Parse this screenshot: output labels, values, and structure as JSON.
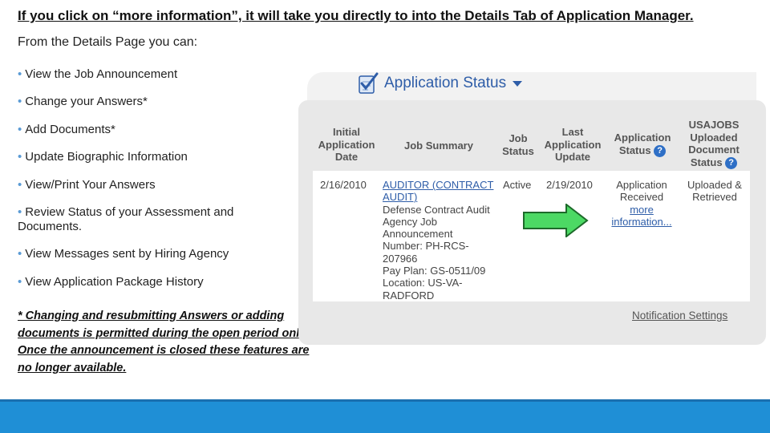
{
  "slide": {
    "title": "If you click on “more information”, it will take you directly to into the Details Tab of Application Manager.",
    "subtitle": "From the Details Page you can:",
    "bullets": [
      "View the Job Announcement",
      "Change your Answers*",
      "Add Documents*",
      "Update Biographic Information",
      "View/Print Your Answers",
      "Review Status of your Assessment and Documents.",
      "View Messages sent by Hiring Agency",
      "View Application Package History"
    ],
    "bullet_glyph": "•",
    "note": "* Changing and resubmitting Answers or adding documents is permitted during the open period only. Once the announcement is closed these features are no longer available."
  },
  "screenshot": {
    "panel_title": "Application Status",
    "headers": {
      "initial_date": [
        "Initial",
        "Application",
        "Date"
      ],
      "job_summary": "Job Summary",
      "job_status": [
        "Job",
        "Status"
      ],
      "last_update": [
        "Last",
        "Application",
        "Update"
      ],
      "app_status": [
        "Application",
        "Status"
      ],
      "usajobs": [
        "USAJOBS",
        "Uploaded",
        "Document",
        "Status"
      ]
    },
    "help_glyph": "?",
    "row": {
      "initial_date": "2/16/2010",
      "job_title": "AUDITOR (CONTRACT AUDIT)",
      "agency": "Defense Contract Audit Agency Job Announcement",
      "number": "Number: PH-RCS-207966",
      "pay_plan": "Pay Plan: GS-0511/09",
      "location": "Location: US-VA-RADFORD",
      "job_status": "Active",
      "last_update": "2/19/2010",
      "app_status_lines": [
        "Application",
        "Received"
      ],
      "more_info": "more information...",
      "doc_status_lines": [
        "Uploaded &",
        "Retrieved"
      ]
    },
    "notification_settings": "Notification Settings"
  },
  "colors": {
    "accent": "#2e5da8",
    "arrow_fill": "#4cd964",
    "footer": "#1f8fd6"
  }
}
